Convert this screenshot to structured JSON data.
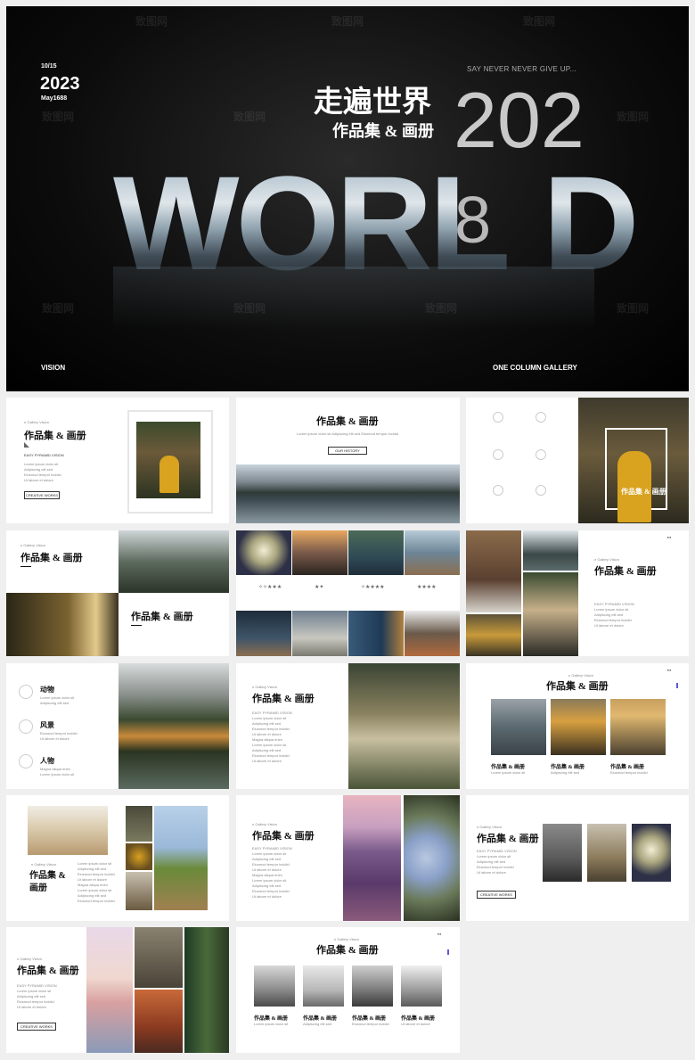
{
  "hero": {
    "date_day": "10/15",
    "year": "2023",
    "date_sub": "May1688",
    "slogan": "SAY NEVER NEVER GIVE UP...",
    "title_cn": "走遍世界",
    "subtitle_cn": "作品集 & 画册",
    "big_number": "202",
    "world": "WORL",
    "world_d": "D",
    "overlay_digit": "8",
    "bottom_left": "VISION",
    "bottom_right": "ONE COLUMN GALLERY",
    "watermark": "致图网"
  },
  "common": {
    "title": "作品集 & 画册",
    "title_two_line_1": "作品集 &",
    "title_two_line_2": "画册",
    "kicker": "n Gallery Vision",
    "easy": "EASY PYRAMID VISION",
    "button": "CREATIVE WORKS",
    "button2": "OUR HISTORY",
    "item_title": "作品集 & 画册",
    "small_lines": [
      "Lorem ipsum dolor sit",
      "Adipiscing elit sed",
      "Eiusmod tempor incidid",
      "Ut labore et dolore",
      "Magna aliqua enim"
    ]
  },
  "s5": {
    "items": [
      {
        "label": "动物"
      },
      {
        "label": "风景"
      },
      {
        "label": "人物"
      }
    ]
  },
  "colors": {
    "accent_purple": "#5b5bd6",
    "dark": "#111111"
  }
}
